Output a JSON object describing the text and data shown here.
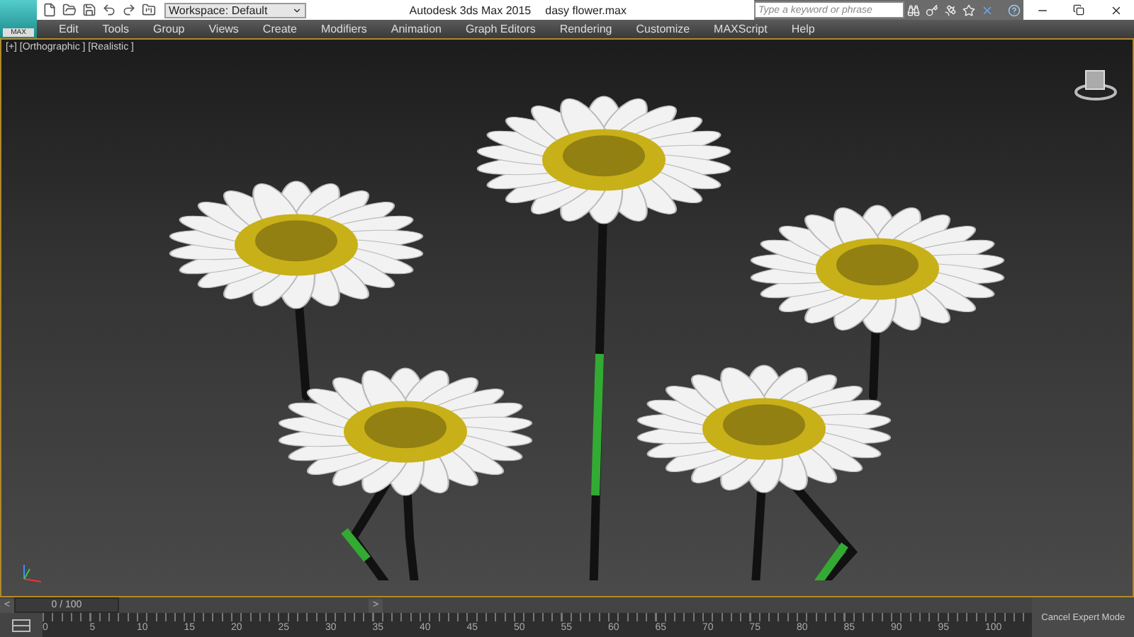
{
  "app_button": {
    "label": "MAX"
  },
  "workspace": {
    "value": "Workspace: Default"
  },
  "window": {
    "title": "Autodesk 3ds Max  2015",
    "file": "dasy flower.max"
  },
  "search": {
    "placeholder": "Type a keyword or phrase"
  },
  "menu": {
    "items": [
      "Edit",
      "Tools",
      "Group",
      "Views",
      "Create",
      "Modifiers",
      "Animation",
      "Graph Editors",
      "Rendering",
      "Customize",
      "MAXScript",
      "Help"
    ]
  },
  "viewport": {
    "label": "[+] [Orthographic ] [Realistic ]"
  },
  "time_slider": {
    "prev": "<",
    "value": "0 / 100",
    "level": 0,
    "next": ">"
  },
  "track_bar": {
    "ticks": [
      "0",
      "5",
      "10",
      "15",
      "20",
      "25",
      "30",
      "35",
      "40",
      "45",
      "50",
      "55",
      "60",
      "65",
      "70",
      "75",
      "80",
      "85",
      "90",
      "95",
      "100"
    ]
  },
  "expert_mode": {
    "label": "Cancel Expert Mode"
  }
}
